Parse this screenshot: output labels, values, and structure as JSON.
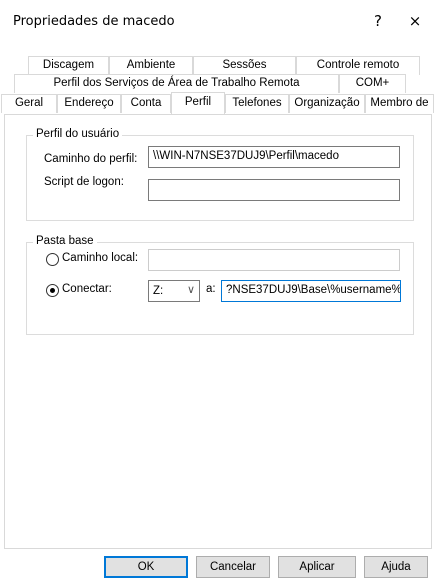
{
  "window": {
    "title": "Propriedades de macedo",
    "help_glyph": "?",
    "close_glyph": "×"
  },
  "tabs": {
    "row1": [
      "Discagem",
      "Ambiente",
      "Sessões",
      "Controle remoto"
    ],
    "row2": [
      "Perfil dos Serviços de Área de Trabalho Remota",
      "COM+"
    ],
    "row3": [
      "Geral",
      "Endereço",
      "Conta",
      "Perfil",
      "Telefones",
      "Organização",
      "Membro de"
    ]
  },
  "profile": {
    "legend": "Perfil do usuário",
    "path_label": "Caminho do perfil:",
    "path_value": "\\\\WIN-N7NSE37DUJ9\\Perfil\\macedo",
    "logon_label": "Script de logon:",
    "logon_value": ""
  },
  "home": {
    "legend": "Pasta base",
    "local_label": "Caminho local:",
    "local_value": "",
    "connect_label": "Conectar:",
    "drive_value": "Z:",
    "to_label": "a:",
    "to_value": "?NSE37DUJ9\\Base\\%username%",
    "selected": "connect"
  },
  "buttons": {
    "ok": "OK",
    "cancel": "Cancelar",
    "apply": "Aplicar",
    "help": "Ajuda"
  }
}
